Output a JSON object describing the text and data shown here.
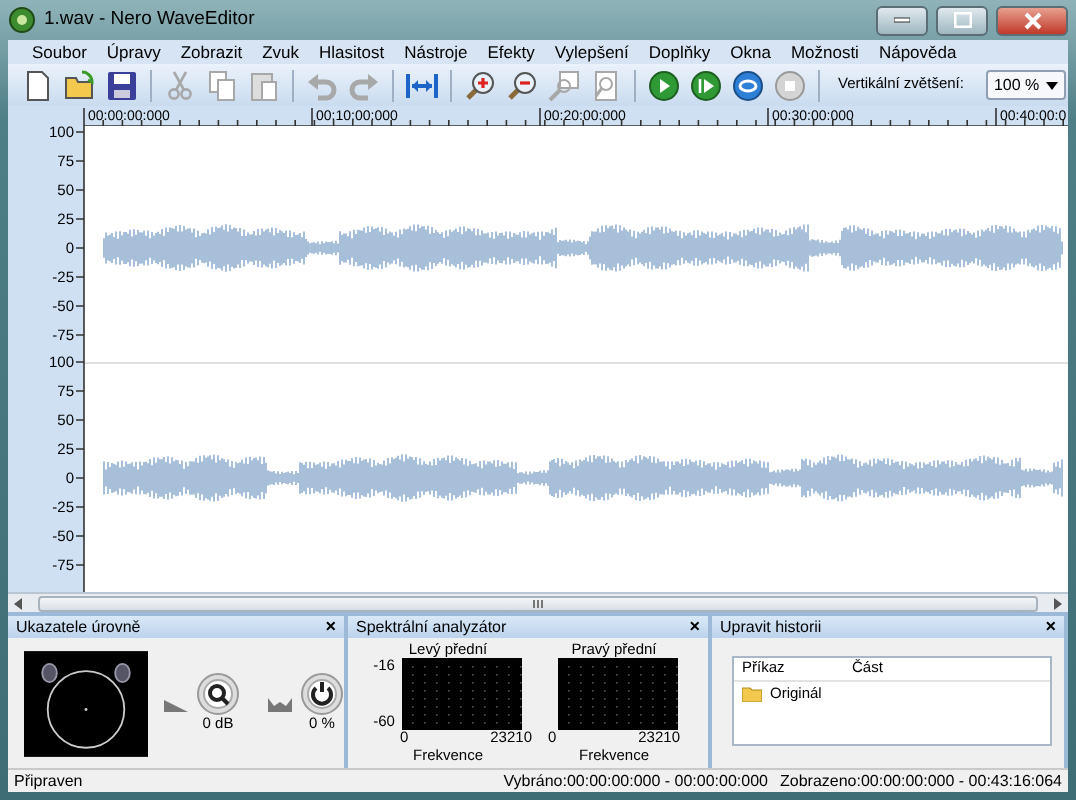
{
  "window": {
    "title": "1.wav - Nero WaveEditor"
  },
  "menu": [
    "Soubor",
    "Úpravy",
    "Zobrazit",
    "Zvuk",
    "Hlasitost",
    "Nástroje",
    "Efekty",
    "Vylepšení",
    "Doplňky",
    "Okna",
    "Možnosti",
    "Nápověda"
  ],
  "toolbar": {
    "buttons": [
      {
        "kind": "new",
        "disabled": false
      },
      {
        "kind": "open",
        "disabled": false
      },
      {
        "kind": "save",
        "disabled": false
      },
      {
        "kind": "separator"
      },
      {
        "kind": "cut",
        "disabled": true
      },
      {
        "kind": "copy",
        "disabled": true
      },
      {
        "kind": "paste",
        "disabled": true
      },
      {
        "kind": "separator"
      },
      {
        "kind": "undo",
        "disabled": true
      },
      {
        "kind": "redo",
        "disabled": true
      },
      {
        "kind": "separator"
      },
      {
        "kind": "fit",
        "disabled": false
      },
      {
        "kind": "separator"
      },
      {
        "kind": "zoomin",
        "disabled": false
      },
      {
        "kind": "zoomout",
        "disabled": false
      },
      {
        "kind": "zoomsel",
        "disabled": true
      },
      {
        "kind": "zoomall",
        "disabled": true
      },
      {
        "kind": "separator"
      },
      {
        "kind": "play",
        "disabled": false
      },
      {
        "kind": "playcursor",
        "disabled": false
      },
      {
        "kind": "loop",
        "disabled": false
      },
      {
        "kind": "stop",
        "disabled": true
      },
      {
        "kind": "separator"
      }
    ],
    "zoom_label": "Vertikální zvětšení:",
    "zoom_value": "100 %"
  },
  "ruler": [
    "00:00:00:000",
    "00:10:00:000",
    "00:20:00:000",
    "00:30:00:000",
    "00:40:00:0"
  ],
  "channels": [
    {
      "ticks": [
        "100",
        "75",
        "50",
        "25",
        "0",
        "-25",
        "-50",
        "-75"
      ]
    },
    {
      "ticks": [
        "100",
        "75",
        "50",
        "25",
        "0",
        "-25",
        "-50",
        "-75"
      ]
    }
  ],
  "panels": {
    "levels": {
      "title": "Ukazatele úrovně",
      "close": "×",
      "knobs": [
        "0 dB",
        "0 %"
      ]
    },
    "spectrum": {
      "title": "Spektrální analyzátor",
      "close": "×",
      "graphs": [
        {
          "label": "Levý přední",
          "y_ticks": [
            "-16",
            "-60"
          ],
          "x_ticks": [
            "0",
            "23210"
          ],
          "xlabel": "Frekvence"
        },
        {
          "label": "Pravý přední",
          "x_ticks": [
            "0",
            "23210"
          ],
          "xlabel": "Frekvence"
        }
      ]
    },
    "history": {
      "title": "Upravit historii",
      "close": "×",
      "columns": [
        "Příkaz",
        "Část"
      ],
      "rows": [
        "Originál"
      ]
    }
  },
  "status_bar": {
    "state": "Připraven",
    "selected": "Vybráno:00:00:00:000 - 00:00:00:000",
    "shown": "Zobrazeno:00:00:00:000 - 00:43:16:064"
  }
}
